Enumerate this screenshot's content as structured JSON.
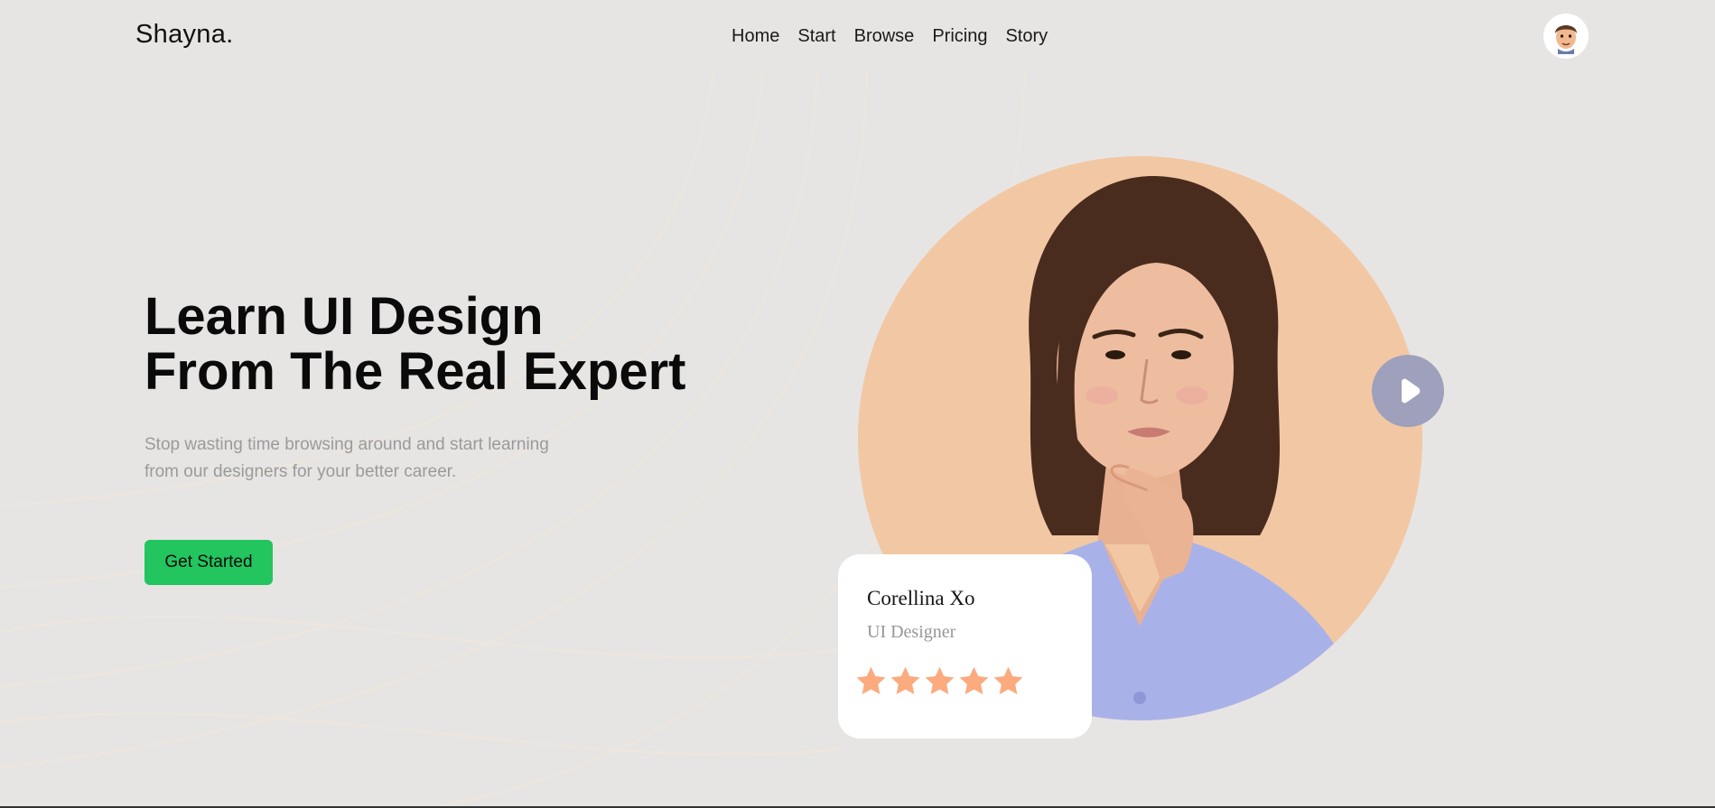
{
  "header": {
    "logo": "Shayna.",
    "nav": [
      {
        "label": "Home"
      },
      {
        "label": "Start"
      },
      {
        "label": "Browse"
      },
      {
        "label": "Pricing"
      },
      {
        "label": "Story"
      }
    ],
    "avatar_icon": "memoji-avatar-icon"
  },
  "hero": {
    "title_line1": "Learn UI Design",
    "title_line2": "From The Real Expert",
    "subtitle_line1": "Stop wasting time browsing around and start learning",
    "subtitle_line2": "from our designers for your better career.",
    "cta_label": "Get Started"
  },
  "expert": {
    "photo": "woman-portrait-photo",
    "play_icon": "play-icon",
    "name": "Corellina Xo",
    "role": "UI Designer",
    "rating": 5,
    "rating_max": 5
  },
  "colors": {
    "background": "#e7e5e4",
    "cta": "#22c55e",
    "circle": "#f2c8a4",
    "play": "#9ea0bc",
    "star": "#fbab7e"
  }
}
